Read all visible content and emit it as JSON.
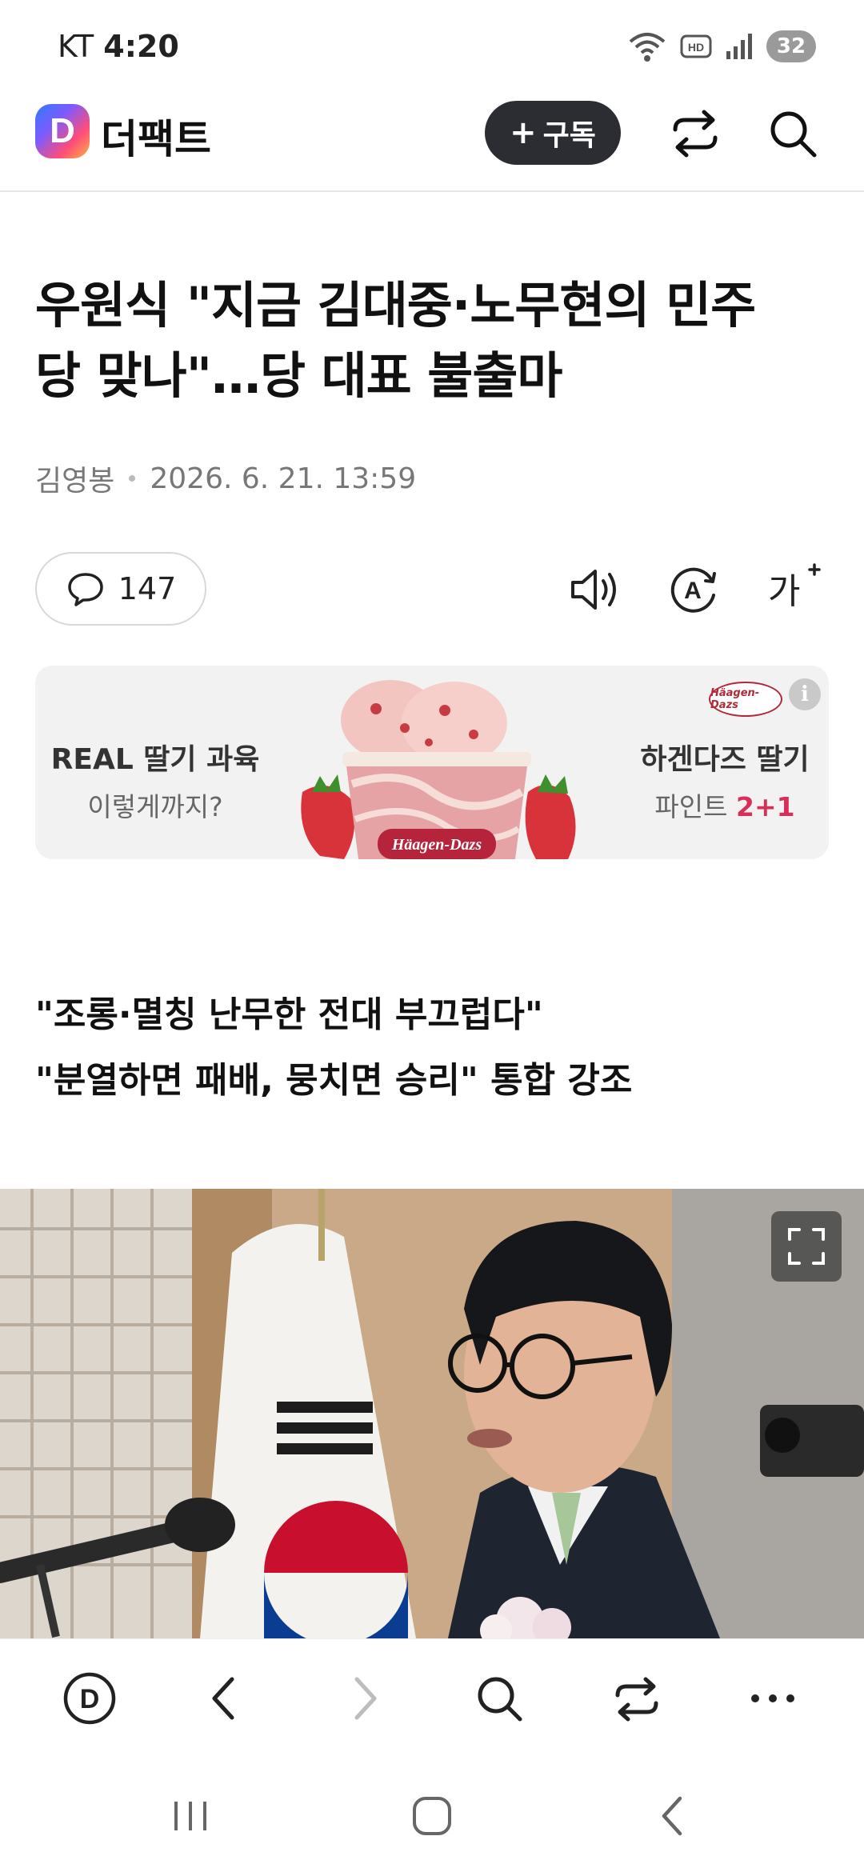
{
  "status_bar": {
    "carrier": "KT",
    "time": "4:20",
    "battery": "32"
  },
  "header": {
    "logo_letter": "D",
    "logo_text": "더팩트",
    "subscribe_label": "구독"
  },
  "article": {
    "headline_line1": "우원식 \"지금 김대중·노무현의 민주",
    "headline_line2": "당 맞나\"…당 대표 불출마",
    "author": "김영봉",
    "datetime": "2026. 6. 21. 13:59",
    "comment_count": "147",
    "subhead_line1": "\"조롱·멸칭 난무한 전대 부끄럽다\"",
    "subhead_line2": "\"분열하면 패배, 뭉치면 승리\" 통합 강조"
  },
  "ad": {
    "left_line1": "REAL 딸기 과육",
    "left_line2": "이렇게까지?",
    "right_line1": "하겐다즈 딸기",
    "right_line2_prefix": "파인트 ",
    "right_line2_highlight": "2+1",
    "brand": "Häagen-Dazs",
    "product_label": "Häagen-Dazs",
    "info_label": "i"
  },
  "colors": {
    "accent_pink": "#d62f5a",
    "subscribe_bg": "#2b2d33",
    "ad_bg": "#f2f2f2"
  }
}
